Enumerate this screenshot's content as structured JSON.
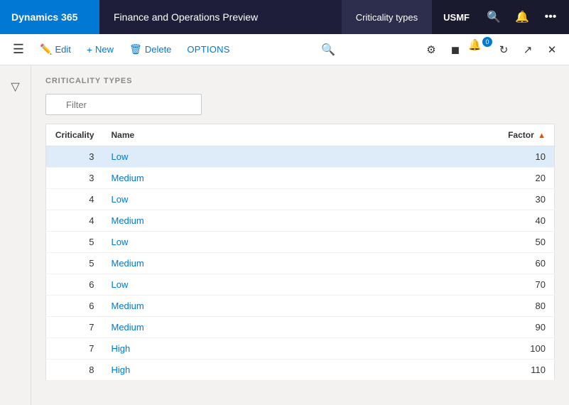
{
  "topNav": {
    "brand": "Dynamics 365",
    "title": "Finance and Operations Preview",
    "page": "Criticality types",
    "company": "USMF"
  },
  "toolbar": {
    "edit": "Edit",
    "new": "New",
    "delete": "Delete",
    "options": "OPTIONS"
  },
  "content": {
    "sectionTitle": "CRITICALITY TYPES",
    "filter": {
      "placeholder": "Filter"
    },
    "table": {
      "columns": [
        {
          "key": "criticality",
          "label": "Criticality"
        },
        {
          "key": "name",
          "label": "Name"
        },
        {
          "key": "factor",
          "label": "Factor"
        }
      ],
      "rows": [
        {
          "criticality": "3",
          "name": "Low",
          "nameClass": "name-low",
          "factor": "10",
          "selected": true
        },
        {
          "criticality": "3",
          "name": "Medium",
          "nameClass": "name-medium",
          "factor": "20",
          "selected": false
        },
        {
          "criticality": "4",
          "name": "Low",
          "nameClass": "name-low",
          "factor": "30",
          "selected": false
        },
        {
          "criticality": "4",
          "name": "Medium",
          "nameClass": "name-medium",
          "factor": "40",
          "selected": false
        },
        {
          "criticality": "5",
          "name": "Low",
          "nameClass": "name-low",
          "factor": "50",
          "selected": false
        },
        {
          "criticality": "5",
          "name": "Medium",
          "nameClass": "name-medium",
          "factor": "60",
          "selected": false
        },
        {
          "criticality": "6",
          "name": "Low",
          "nameClass": "name-low",
          "factor": "70",
          "selected": false
        },
        {
          "criticality": "6",
          "name": "Medium",
          "nameClass": "name-medium",
          "factor": "80",
          "selected": false
        },
        {
          "criticality": "7",
          "name": "Medium",
          "nameClass": "name-medium",
          "factor": "90",
          "selected": false
        },
        {
          "criticality": "7",
          "name": "High",
          "nameClass": "name-high",
          "factor": "100",
          "selected": false
        },
        {
          "criticality": "8",
          "name": "High",
          "nameClass": "name-high",
          "factor": "110",
          "selected": false
        }
      ]
    }
  }
}
